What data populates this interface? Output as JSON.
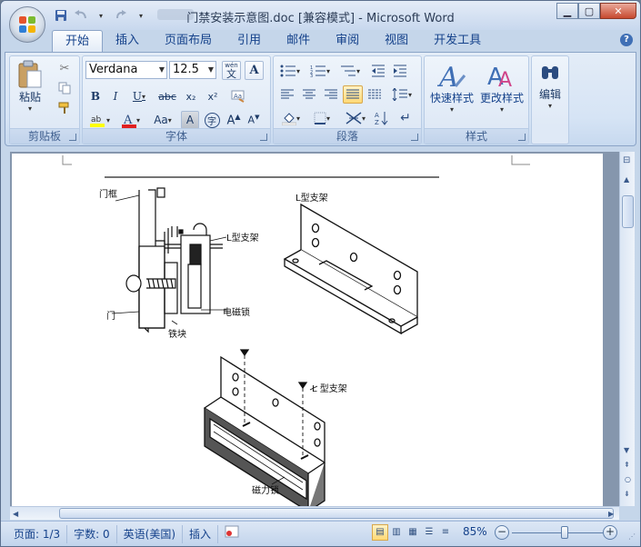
{
  "window": {
    "title": "门禁安装示意图.doc [兼容模式] - Microsoft Word"
  },
  "quick_access": {
    "save_icon": "save-icon",
    "undo_icon": "undo-icon",
    "redo_icon": "redo-icon",
    "customize_icon": "customize-qat-icon"
  },
  "ribbon": {
    "tabs": [
      "开始",
      "插入",
      "页面布局",
      "引用",
      "邮件",
      "审阅",
      "视图",
      "开发工具"
    ],
    "active_tab": "开始",
    "clipboard": {
      "label": "剪贴板",
      "paste_label": "粘贴"
    },
    "font": {
      "label": "字体",
      "font_name": "Verdana",
      "font_size": "12.5",
      "phonetic_glyph": "wén",
      "aa_glyph": "Aa"
    },
    "paragraph": {
      "label": "段落"
    },
    "styles": {
      "label": "样式",
      "quick_styles_label": "快速样式",
      "change_styles_label": "更改样式"
    },
    "editing": {
      "label": "编辑"
    }
  },
  "diagram": {
    "door_frame_label": "门框",
    "l_bracket_label_small": "L型支架",
    "l_bracket_label": "L型支架",
    "electromagnetic_lock_label": "电磁锁",
    "door_label": "门",
    "iron_block_label": "铁块",
    "bracket_label_bottom": "L 型支架",
    "magnetic_lock_label": "磁力锁"
  },
  "status_bar": {
    "page": "页面: 1/3",
    "word_count": "字数: 0",
    "language": "英语(美国)",
    "insert_mode": "插入",
    "zoom": "85%",
    "zoom_level": 0.58
  }
}
